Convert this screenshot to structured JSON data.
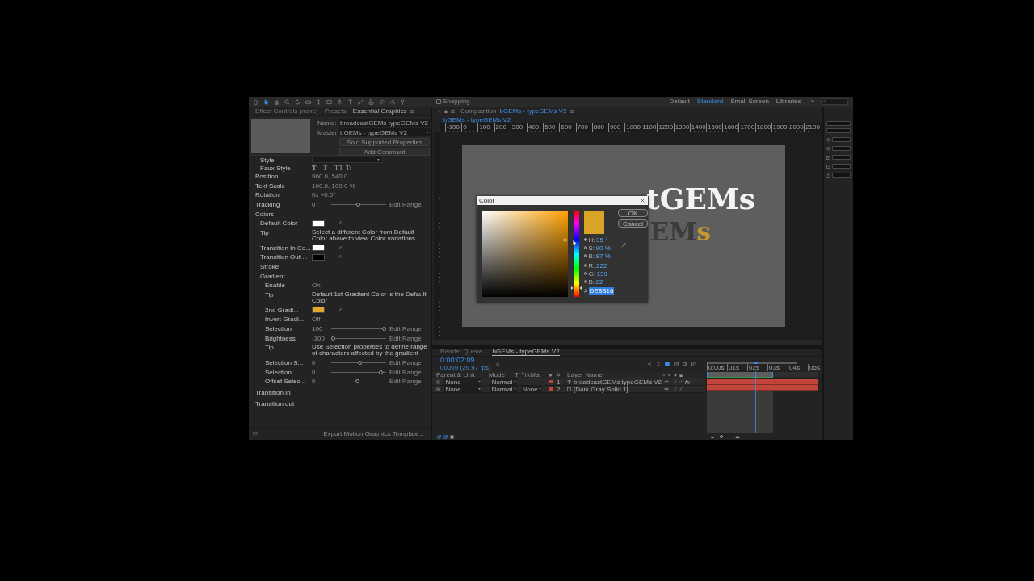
{
  "toolbar": {
    "tools": [
      {
        "kind": "home",
        "selected": false
      },
      {
        "kind": "pointer",
        "selected": true
      },
      {
        "kind": "hand",
        "selected": false
      },
      {
        "kind": "zoom",
        "selected": false
      },
      {
        "kind": "rotate",
        "selected": false
      },
      {
        "kind": "camera",
        "selected": false
      },
      {
        "kind": "pan",
        "selected": false
      },
      {
        "kind": "rectangle",
        "selected": false
      },
      {
        "kind": "pen",
        "selected": false
      },
      {
        "kind": "type",
        "selected": false
      },
      {
        "kind": "brush",
        "selected": false
      },
      {
        "kind": "stamp",
        "selected": false
      },
      {
        "kind": "eraser",
        "selected": false
      },
      {
        "kind": "roto",
        "selected": false
      },
      {
        "kind": "pin",
        "selected": false
      }
    ],
    "snapping": {
      "label": "Snapping",
      "checked": false
    },
    "workspaces": [
      {
        "label": "Default",
        "selected": false
      },
      {
        "label": "Standard",
        "selected": true
      },
      {
        "label": "Small Screen",
        "selected": false
      },
      {
        "label": "Libraries",
        "selected": false
      }
    ],
    "overflow": "»"
  },
  "left_panel": {
    "tabs": [
      {
        "label": "Effect Controls (none)",
        "selected": false
      },
      {
        "label": "Presets",
        "selected": false
      },
      {
        "label": "Essential Graphics",
        "selected": true
      }
    ],
    "name": {
      "label": "Name:",
      "value": "broadcastGEMs typeGEMs V2"
    },
    "master": {
      "label": "Master:",
      "value": "bGEMs - typeGEMs V2"
    },
    "buttons": [
      "Solo Supported Properties",
      "Add Comment"
    ],
    "properties": [
      {
        "kind": "group",
        "children": [
          {
            "kind": "dropdown",
            "label": "Style"
          },
          {
            "kind": "styles",
            "label": "Faux Style",
            "buttons": [
              {
                "text": "T",
                "kind": "bold"
              },
              {
                "text": "T",
                "kind": "italic"
              },
              {
                "text": "TT",
                "kind": "caps"
              },
              {
                "text": "Tt",
                "kind": "smallcaps"
              }
            ]
          }
        ]
      },
      {
        "kind": "value",
        "label": "Position",
        "value": "960.0, 540.0"
      },
      {
        "kind": "value",
        "label": "Text Scale",
        "value": "100.0, 100.0 %"
      },
      {
        "kind": "value",
        "label": "Rotation",
        "value": "0x +0.0°"
      },
      {
        "kind": "slider",
        "label": "Tracking",
        "value": "0",
        "level": 0.49,
        "action": "Edit Range"
      },
      {
        "kind": "group",
        "label": "Colors",
        "children": [
          {
            "kind": "swatch",
            "label": "Default Color",
            "color": "#ffffff"
          },
          {
            "kind": "tip",
            "label": "Tip",
            "value": "Select a different Color from Default Color above to view Color variations"
          },
          {
            "kind": "swatch",
            "label": "Transition In Co...",
            "color": "#ffffff"
          },
          {
            "kind": "swatch",
            "label": "Transition Out ...",
            "color": "#000000"
          },
          {
            "kind": "heading",
            "label": "Stroke"
          },
          {
            "kind": "group",
            "label": "Gradient",
            "children": [
              {
                "kind": "value",
                "label": "Enable",
                "value": "On"
              },
              {
                "kind": "tip",
                "label": "Tip",
                "value": "Default 1st Gradient Color is the Default Color"
              },
              {
                "kind": "swatch",
                "label": "2nd Gradi...",
                "color": "#e0a82c"
              },
              {
                "kind": "value",
                "label": "Invert Gradi...",
                "value": "Off"
              },
              {
                "kind": "slider",
                "label": "Selection",
                "value": "100",
                "level": 1,
                "action": "Edit Range"
              },
              {
                "kind": "slider",
                "label": "Brightness",
                "value": "-100",
                "level": 0,
                "action": "Edit Range"
              },
              {
                "kind": "tip",
                "label": "Tip",
                "value": "Use Selection properties to define range of characters affected by the gradient"
              },
              {
                "kind": "slider",
                "label": "Selection S...",
                "value": "0",
                "level": 0.53,
                "action": "Edit Range"
              },
              {
                "kind": "slider",
                "label": "Selection ...",
                "value": "0",
                "level": 0.93,
                "action": "Edit Range"
              },
              {
                "kind": "slider",
                "label": "Offset Selec...",
                "value": "0",
                "level": 0.48,
                "action": "Edit Range"
              }
            ]
          }
        ]
      },
      {
        "kind": "section",
        "label": "Transition In"
      },
      {
        "kind": "section",
        "label": "Transition out"
      }
    ],
    "footer": {
      "button": "Export Motion Graphics Template..."
    }
  },
  "composition": {
    "header": {
      "label": "Composition",
      "link": "bGEMs - typeGEMs V2"
    },
    "tabs": [
      {
        "label": "bGEMs - typeGEMs V2",
        "selected": true
      }
    ],
    "ruler": [
      "-100",
      "0",
      "100",
      "200",
      "300",
      "400",
      "500",
      "600",
      "700",
      "800",
      "900",
      "1000",
      "1100",
      "1200",
      "1300",
      "1400",
      "1500",
      "1600",
      "1700",
      "1800",
      "1900",
      "2000",
      "2100"
    ],
    "canvas": {
      "lines": [
        {
          "kind": "title",
          "runs": [
            {
              "text": "tGEMs",
              "kind": "plain"
            }
          ]
        },
        {
          "kind": "subtitle",
          "runs": [
            {
              "text": "EM",
              "kind": "plain"
            },
            {
              "text": "s",
              "kind": "accent"
            }
          ]
        }
      ]
    }
  },
  "color_dialog": {
    "title": "Color",
    "buttons": [
      {
        "label": "OK",
        "kind": "primary"
      },
      {
        "label": "Cancel",
        "kind": "secondary"
      }
    ],
    "hue": {
      "level": 0.1
    },
    "preview": {
      "color": "#dba326"
    },
    "hsb": [
      {
        "label": "H:",
        "value": "35",
        "unit": "°",
        "selected": true
      },
      {
        "label": "S:",
        "value": "90",
        "unit": "%",
        "selected": false
      },
      {
        "label": "B:",
        "value": "87",
        "unit": "%",
        "selected": false
      }
    ],
    "rgb": [
      {
        "label": "R:",
        "value": "222",
        "selected": false
      },
      {
        "label": "G:",
        "value": "139",
        "selected": false
      },
      {
        "label": "B:",
        "value": "22",
        "selected": false
      }
    ],
    "hex": {
      "label": "#",
      "value": "DE8B16"
    }
  },
  "timeline": {
    "tabs": [
      {
        "label": "Render Queue",
        "selected": false
      },
      {
        "label": "bGEMs - typeGEMs V2",
        "selected": true
      }
    ],
    "timecode": "0:00:02:09",
    "frames": "00069 (29.97 fps)",
    "switches": [
      {
        "kind": "branch",
        "on": false
      },
      {
        "kind": "figure",
        "on": false
      },
      {
        "kind": "frame",
        "on": true
      },
      {
        "kind": "stack",
        "on": false
      },
      {
        "kind": "blur",
        "on": false
      },
      {
        "kind": "graph",
        "on": false
      }
    ],
    "columns": [
      {
        "label": "Parent & Link",
        "kind": "parent"
      },
      {
        "label": "Mode",
        "kind": "mode"
      },
      {
        "label": "T",
        "kind": "preserve"
      },
      {
        "label": "TrkMat",
        "kind": "matte"
      },
      {
        "label": "#",
        "kind": "number"
      },
      {
        "label": "Layer Name",
        "kind": "name"
      }
    ],
    "layers": [
      {
        "number": "1",
        "kind": "text",
        "name": "broadcastGEMs typeGEMs V2",
        "parent": "None",
        "mode": "Normal",
        "effect": "fx",
        "color": "#c2443a"
      },
      {
        "number": "2",
        "kind": "solid",
        "name": "[Dark Gray Solid 1]",
        "parent": "None",
        "mode": "Normal",
        "trkmat": "None",
        "color": "#c2443a"
      }
    ],
    "ruler": [
      "0:00s",
      "01s",
      "02s",
      "03s",
      "04s",
      "05s"
    ],
    "navigator": {
      "level": 0.82
    },
    "work_area": {
      "level": 0.6
    },
    "playhead": {
      "level": 0.445
    },
    "zoom": {
      "level": 0.3
    }
  }
}
